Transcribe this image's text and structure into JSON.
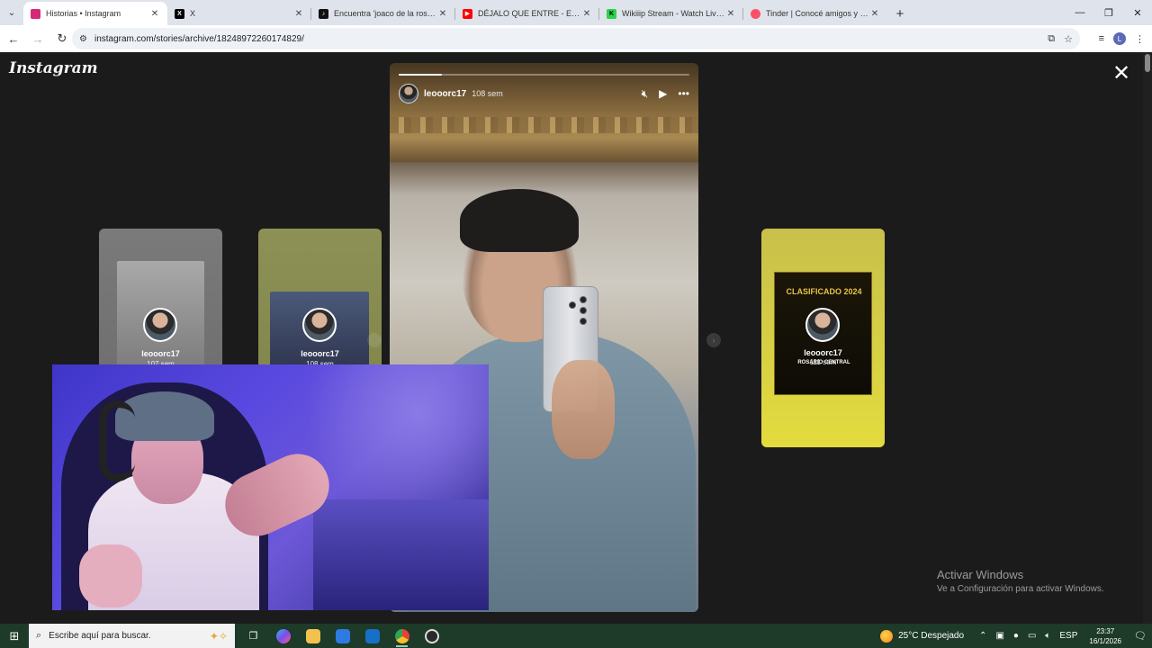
{
  "browser": {
    "tabs": [
      {
        "label": "Historias • Instagram",
        "favicon": "instagram-icon",
        "color": "#d62976",
        "active": true
      },
      {
        "label": "X",
        "favicon": "x-icon",
        "color": "#000000",
        "active": false
      },
      {
        "label": "Encuentra 'joaco de la rosa tem",
        "favicon": "tiktok-icon",
        "color": "#111111",
        "active": false
      },
      {
        "label": "DÉJALO QUE ENTRE - Elian G (A",
        "favicon": "youtube-icon",
        "color": "#ff0000",
        "active": false
      },
      {
        "label": "Wikiiip Stream - Watch Live on",
        "favicon": "kick-icon",
        "color": "#2bd34a",
        "active": false
      },
      {
        "label": "Tinder | Conocé amigos y gent",
        "favicon": "tinder-icon",
        "color": "#fd5068",
        "active": false
      }
    ],
    "url": "instagram.com/stories/archive/18248972260174829/",
    "profile_initial": "L"
  },
  "page": {
    "logo": "Instagram",
    "story": {
      "username": "leooorc17",
      "time": "108 sem",
      "progress": 0.15
    },
    "cards": [
      {
        "username": "leooorc17",
        "time": "107 sem"
      },
      {
        "username": "leooorc17",
        "time": "108 sem"
      },
      {
        "username": "leooorc17",
        "time": "111 sem",
        "poster_title": "CLASIFICADO 2024",
        "poster_sub": "ROSARIO CENTRAL"
      }
    ],
    "activate_windows": {
      "title": "Activar Windows",
      "subtitle": "Ve a Configuración para activar Windows."
    }
  },
  "taskbar": {
    "search_placeholder": "Escribe aquí para buscar.",
    "weather": "25°C  Despejado",
    "lang": "ESP",
    "time": "23:37",
    "date": "16/1/2026"
  }
}
